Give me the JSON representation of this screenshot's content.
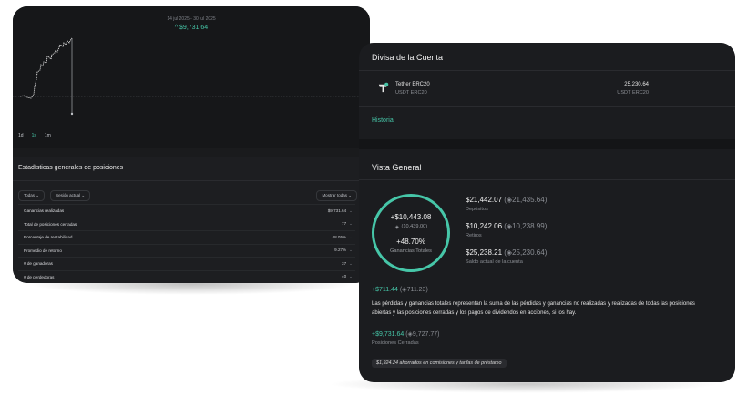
{
  "chart_panel": {
    "date_range": "14 jul 2025 - 30 jul 2025",
    "change": "^ $9,731.64",
    "timeframes": [
      {
        "label": "1d",
        "active": false
      },
      {
        "label": "1s",
        "active": true
      },
      {
        "label": "1m",
        "active": false
      }
    ],
    "accent_color": "#46c6a8"
  },
  "stats": {
    "title": "Estadísticas generales de posiciones",
    "filter_all": "Todas",
    "filter_session": "Sesión actual",
    "show_all": "Mostrar todas",
    "rows": [
      {
        "label": "Ganancias realizadas",
        "value": "$9,731.64"
      },
      {
        "label": "Total de posiciones cerradas",
        "value": "77"
      },
      {
        "label": "Porcentaje de rentabilidad",
        "value": "48.05%"
      },
      {
        "label": "Promedio de retorno",
        "value": "9.27%"
      },
      {
        "label": "# de ganadoras",
        "value": "37"
      },
      {
        "label": "# de perdedoras",
        "value": "40"
      }
    ]
  },
  "currency": {
    "title": "Divisa de la Cuenta",
    "asset_name": "Tether ERC20",
    "asset_symbol": "USDT ERC20",
    "balance": "25,230.64",
    "balance_symbol": "USDT ERC20",
    "history_link": "Historial"
  },
  "overview": {
    "title": "Vista General",
    "ring_value": "+$10,443.08",
    "ring_usdt": "(10,439.00)",
    "ring_pct": "+48.70%",
    "ring_label": "Ganancias Totales",
    "deposits_amt": "$21,442.07",
    "deposits_usdt": "21,435.64",
    "deposits_label": "Depósitos",
    "withdrawals_amt": "$10,242.06",
    "withdrawals_usdt": "10,238.99",
    "withdrawals_label": "Retiros",
    "balance_amt": "$25,238.21",
    "balance_usdt": "25,230.64",
    "balance_label": "Saldo actual de la cuenta",
    "pnl_amt": "+$711.44",
    "pnl_usdt": "711.23",
    "description": "Las pérdidas y ganancias totales representan la suma de las pérdidas y ganancias no realizadas y realizadas de todas las posiciones abiertas y las posiciones cerradas y los pagos de dividendos en acciones, si los hay.",
    "closed_amt": "+$9,731.64",
    "closed_usdt": "9,727.77",
    "closed_label": "Posiciones Cerradas",
    "savings": "$1,924.24 ahorrados en comisiones y tarifas de préstamo"
  }
}
